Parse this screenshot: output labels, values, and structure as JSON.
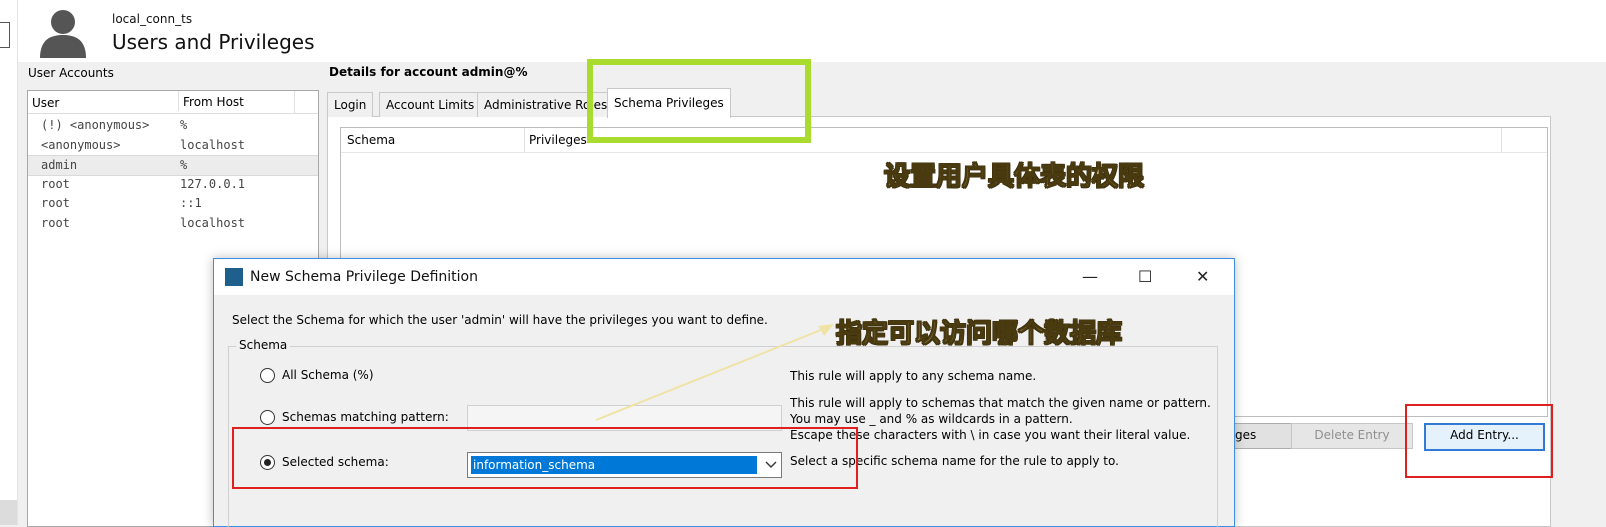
{
  "header": {
    "connection": "local_conn_ts",
    "title": "Users and Privileges"
  },
  "user_accounts": {
    "label": "User Accounts",
    "columns": [
      "User",
      "From Host"
    ],
    "rows": [
      {
        "user": "(!) <anonymous>",
        "host": "%"
      },
      {
        "user": "<anonymous>",
        "host": "localhost"
      },
      {
        "user": "admin",
        "host": "%"
      },
      {
        "user": "root",
        "host": "127.0.0.1"
      },
      {
        "user": "root",
        "host": "::1"
      },
      {
        "user": "root",
        "host": "localhost"
      }
    ],
    "selected_index": 2
  },
  "details": {
    "label": "Details for account admin@%",
    "tabs": [
      "Login",
      "Account Limits",
      "Administrative Roles",
      "Schema Privileges"
    ],
    "active_tab": "Schema Privileges",
    "table_columns": [
      "Schema",
      "Privileges"
    ],
    "buttons": {
      "revoke_partial": "ges",
      "delete_entry": "Delete Entry",
      "add_entry": "Add Entry..."
    }
  },
  "annotations": {
    "table_note": "设置用户具体表的权限",
    "schema_note": "指定可以访问哪个数据库"
  },
  "dialog": {
    "title": "New Schema Privilege Definition",
    "controls": {
      "minimize": "—",
      "maximize": "☐",
      "close": "✕"
    },
    "intro": "Select the Schema for which the user 'admin' will have the privileges you want to define.",
    "group_label": "Schema",
    "options": [
      {
        "label": "All Schema (%)",
        "desc": [
          "This rule will apply to any schema name."
        ]
      },
      {
        "label": "Schemas matching pattern:",
        "desc": [
          "This rule will apply to schemas that match the given name or pattern.",
          "You may use _ and % as wildcards in a pattern.",
          "Escape these characters with \\ in case you want their literal value."
        ]
      },
      {
        "label": "Selected schema:",
        "desc": [
          "Select a specific schema name for the rule to apply to."
        ]
      }
    ],
    "selected_option": "Selected schema:",
    "pattern_value": "",
    "selected_schema": "information_schema"
  },
  "colors": {
    "highlight_green": "#a9dc2e",
    "highlight_red": "#e21f1f",
    "selection_blue": "#0078d7",
    "dialog_border": "#3d8ee0"
  }
}
